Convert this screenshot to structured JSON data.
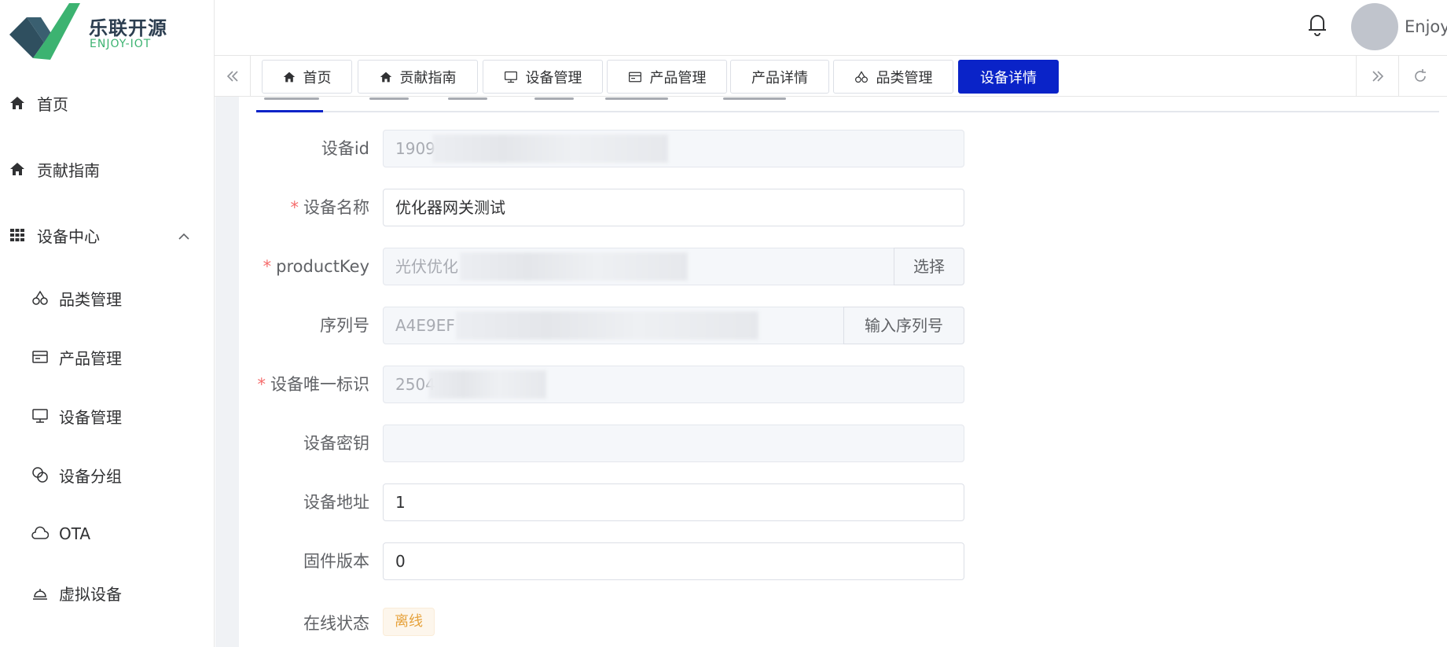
{
  "logo": {
    "title": "乐联开源",
    "subtitle": "ENJOY-IOT",
    "colors": {
      "dark": "#2f4f5f",
      "green": "#3cb371"
    }
  },
  "sidebar": {
    "items": [
      {
        "label": "首页",
        "icon": "home-icon"
      },
      {
        "label": "贡献指南",
        "icon": "home-icon"
      },
      {
        "label": "设备中心",
        "icon": "grid-icon",
        "expanded": true
      },
      {
        "label": "品类管理",
        "icon": "cherry-icon"
      },
      {
        "label": "产品管理",
        "icon": "card-icon"
      },
      {
        "label": "设备管理",
        "icon": "monitor-icon"
      },
      {
        "label": "设备分组",
        "icon": "link-icon"
      },
      {
        "label": "OTA",
        "icon": "cloud-icon"
      },
      {
        "label": "虚拟设备",
        "icon": "bell-dome-icon"
      }
    ]
  },
  "header": {
    "username": "Enjoy",
    "notification_icon": "bell-icon"
  },
  "tabs": [
    {
      "label": "首页",
      "icon": "home-icon"
    },
    {
      "label": "贡献指南",
      "icon": "home-icon"
    },
    {
      "label": "设备管理",
      "icon": "monitor-icon"
    },
    {
      "label": "产品管理",
      "icon": "card-icon"
    },
    {
      "label": "产品详情",
      "icon": ""
    },
    {
      "label": "品类管理",
      "icon": "cherry-icon"
    },
    {
      "label": "设备详情",
      "icon": "",
      "active": true
    }
  ],
  "accent_color": "#0a23c8",
  "form": {
    "device_id": {
      "label": "设备id",
      "value": "1909",
      "disabled": true
    },
    "device_name": {
      "label": "设备名称",
      "required": true,
      "value": "优化器网关测试"
    },
    "product_key": {
      "label": "productKey",
      "required": true,
      "value": "光伏优化",
      "disabled": true,
      "append": "选择"
    },
    "serial_no": {
      "label": "序列号",
      "value": "A4E9EF",
      "disabled": true,
      "append": "输入序列号"
    },
    "unique_id": {
      "label": "设备唯一标识",
      "required": true,
      "value": "2504",
      "disabled": true
    },
    "secret": {
      "label": "设备密钥",
      "value": "",
      "disabled": true
    },
    "address": {
      "label": "设备地址",
      "value": "1"
    },
    "firmware": {
      "label": "固件版本",
      "value": "0"
    },
    "online": {
      "label": "在线状态",
      "tag": "离线"
    }
  }
}
